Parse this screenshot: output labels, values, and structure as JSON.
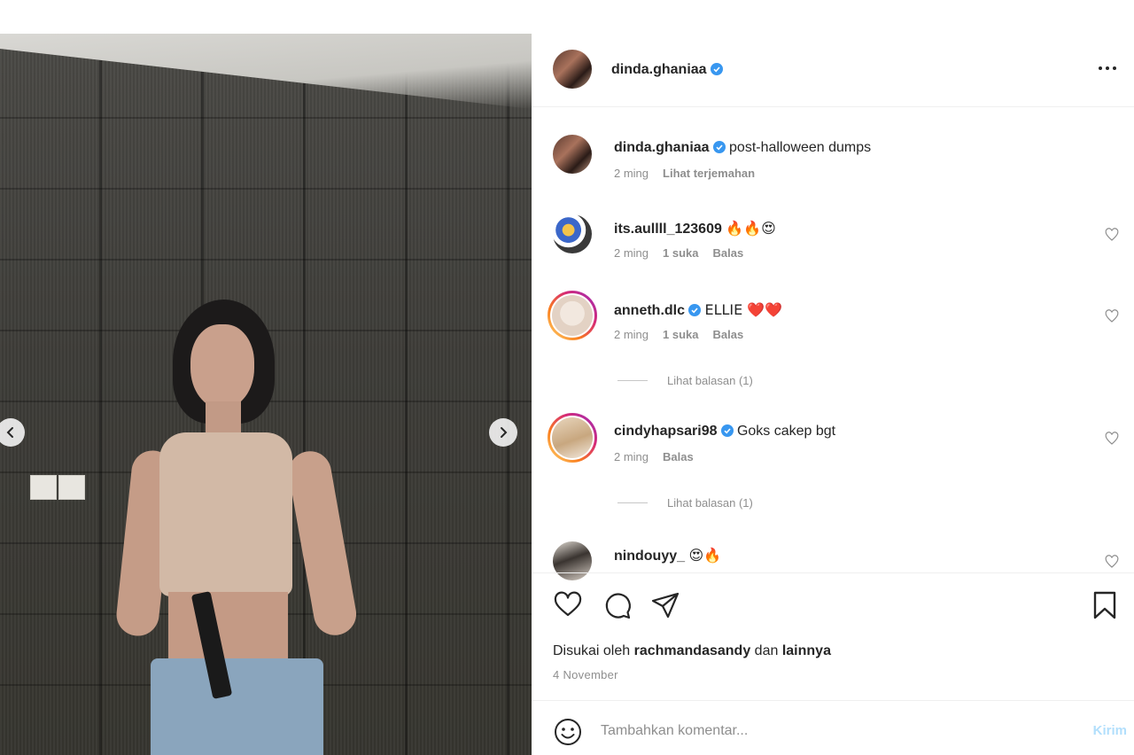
{
  "post": {
    "owner": "dinda.ghaniaa",
    "caption": "post-halloween dumps",
    "caption_time": "2 ming",
    "translate_label": "Lihat terjemahan",
    "carousel_dots": 8,
    "carousel_active_index": 3
  },
  "comments": [
    {
      "username": "its.aullll_123609",
      "text": "🔥🔥😍",
      "verified": false,
      "time": "2 ming",
      "likes": "1 suka",
      "reply": "Balas"
    },
    {
      "username": "anneth.dlc",
      "text": "ELLIE ❤️❤️",
      "verified": true,
      "time": "2 ming",
      "likes": "1 suka",
      "reply": "Balas",
      "view_replies": "Lihat balasan (1)"
    },
    {
      "username": "cindyhapsari98",
      "text": "Goks cakep bgt",
      "verified": true,
      "time": "2 ming",
      "reply": "Balas",
      "view_replies": "Lihat balasan (1)"
    },
    {
      "username": "nindouyy_",
      "text": "😍🔥",
      "verified": false
    }
  ],
  "likes_line": {
    "prefix": "Disukai oleh",
    "user": "rachmandasandy",
    "middle": "dan",
    "suffix": "lainnya"
  },
  "post_date": "4 November",
  "composer": {
    "placeholder": "Tambahkan komentar...",
    "send_label": "Kirim"
  },
  "icons": {
    "more": "more-horizontal-icon",
    "like": "heart-icon",
    "comment": "comment-icon",
    "share": "send-icon",
    "save": "bookmark-icon",
    "emoji": "smile-icon",
    "verified": "verified-badge-icon",
    "prev": "chevron-left-icon",
    "next": "chevron-right-icon"
  },
  "colors": {
    "verified": "#3897f0",
    "muted": "#8e8e8e",
    "send_disabled": "#b2dffc"
  }
}
